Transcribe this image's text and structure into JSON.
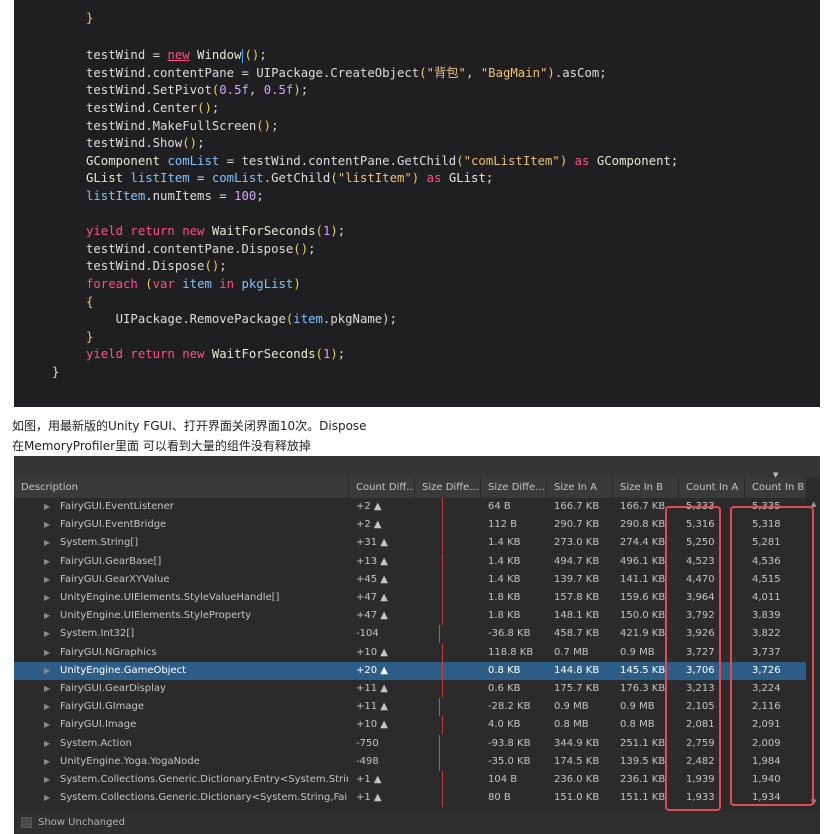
{
  "code_lines": [
    [
      {
        "t": "}",
        "c": "t-punc"
      }
    ],
    [],
    [
      {
        "t": "testWind = ",
        "c": "t-plain"
      },
      {
        "t": "new",
        "c": "t-new"
      },
      {
        "t": " Window",
        "c": "t-type"
      },
      {
        "t": "()",
        "c": "t-punc"
      },
      {
        "t": ";",
        "c": "t-plain"
      }
    ],
    [
      {
        "t": "testWind.contentPane = UIPackage.CreateObject",
        "c": "t-plain"
      },
      {
        "t": "(",
        "c": "t-punc"
      },
      {
        "t": "\"背包\"",
        "c": "t-str"
      },
      {
        "t": ", ",
        "c": "t-plain"
      },
      {
        "t": "\"BagMain\"",
        "c": "t-str"
      },
      {
        "t": ")",
        "c": "t-punc"
      },
      {
        "t": ".asCom;",
        "c": "t-plain"
      }
    ],
    [
      {
        "t": "testWind.SetPivot",
        "c": "t-plain"
      },
      {
        "t": "(",
        "c": "t-punc"
      },
      {
        "t": "0.5f",
        "c": "t-num"
      },
      {
        "t": ", ",
        "c": "t-plain"
      },
      {
        "t": "0.5f",
        "c": "t-num"
      },
      {
        "t": ")",
        "c": "t-punc"
      },
      {
        "t": ";",
        "c": "t-plain"
      }
    ],
    [
      {
        "t": "testWind.Center",
        "c": "t-plain"
      },
      {
        "t": "()",
        "c": "t-punc"
      },
      {
        "t": ";",
        "c": "t-plain"
      }
    ],
    [
      {
        "t": "testWind.MakeFullScreen",
        "c": "t-plain"
      },
      {
        "t": "()",
        "c": "t-punc"
      },
      {
        "t": ";",
        "c": "t-plain"
      }
    ],
    [
      {
        "t": "testWind.Show",
        "c": "t-plain"
      },
      {
        "t": "()",
        "c": "t-punc"
      },
      {
        "t": ";",
        "c": "t-plain"
      }
    ],
    [
      {
        "t": "GComponent ",
        "c": "t-type"
      },
      {
        "t": "comList",
        "c": "t-var"
      },
      {
        "t": " = testWind.contentPane.GetChild",
        "c": "t-plain"
      },
      {
        "t": "(",
        "c": "t-punc"
      },
      {
        "t": "\"comListItem\"",
        "c": "t-str"
      },
      {
        "t": ")",
        "c": "t-punc"
      },
      {
        "t": " as",
        "c": "t-kw"
      },
      {
        "t": " GComponent;",
        "c": "t-type"
      }
    ],
    [
      {
        "t": "GList ",
        "c": "t-type"
      },
      {
        "t": "listItem",
        "c": "t-var"
      },
      {
        "t": " = ",
        "c": "t-plain"
      },
      {
        "t": "comList",
        "c": "t-var"
      },
      {
        "t": ".GetChild",
        "c": "t-plain"
      },
      {
        "t": "(",
        "c": "t-punc"
      },
      {
        "t": "\"listItem\"",
        "c": "t-str"
      },
      {
        "t": ")",
        "c": "t-punc"
      },
      {
        "t": " as",
        "c": "t-kw"
      },
      {
        "t": " GList;",
        "c": "t-type"
      }
    ],
    [
      {
        "t": "listItem",
        "c": "t-var"
      },
      {
        "t": ".numItems = ",
        "c": "t-plain"
      },
      {
        "t": "100",
        "c": "t-num"
      },
      {
        "t": ";",
        "c": "t-plain"
      }
    ],
    [],
    [
      {
        "t": "yield return new",
        "c": "t-kw"
      },
      {
        "t": " WaitForSeconds",
        "c": "t-type"
      },
      {
        "t": "(",
        "c": "t-punc"
      },
      {
        "t": "1",
        "c": "t-num"
      },
      {
        "t": ")",
        "c": "t-punc"
      },
      {
        "t": ";",
        "c": "t-plain"
      }
    ],
    [
      {
        "t": "testWind.contentPane.Dispose",
        "c": "t-plain"
      },
      {
        "t": "()",
        "c": "t-punc"
      },
      {
        "t": ";",
        "c": "t-plain"
      }
    ],
    [
      {
        "t": "testWind.Dispose",
        "c": "t-plain"
      },
      {
        "t": "()",
        "c": "t-punc"
      },
      {
        "t": ";",
        "c": "t-plain"
      }
    ],
    [
      {
        "t": "foreach",
        "c": "t-kw"
      },
      {
        "t": " (",
        "c": "t-punc"
      },
      {
        "t": "var",
        "c": "t-kw"
      },
      {
        "t": " item ",
        "c": "t-var"
      },
      {
        "t": "in",
        "c": "t-kw"
      },
      {
        "t": " pkgList",
        "c": "t-var"
      },
      {
        "t": ")",
        "c": "t-punc"
      }
    ],
    [
      {
        "t": "{",
        "c": "t-punc"
      }
    ],
    [
      {
        "t": "    UIPackage.RemovePackage",
        "c": "t-plain"
      },
      {
        "t": "(",
        "c": "t-punc"
      },
      {
        "t": "item",
        "c": "t-var"
      },
      {
        "t": ".pkgName)",
        "c": "t-plain"
      },
      {
        "t": ";",
        "c": "t-plain"
      }
    ],
    [
      {
        "t": "}",
        "c": "t-punc"
      }
    ],
    [
      {
        "t": "yield return new",
        "c": "t-kw"
      },
      {
        "t": " WaitForSeconds",
        "c": "t-type"
      },
      {
        "t": "(",
        "c": "t-punc"
      },
      {
        "t": "1",
        "c": "t-num"
      },
      {
        "t": ")",
        "c": "t-punc"
      },
      {
        "t": ";",
        "c": "t-plain"
      }
    ],
    [
      {
        "t": "}",
        "c": "t-plain"
      }
    ]
  ],
  "caption": {
    "line1": "如图，用最新版的Unity FGUI、打开界面关闭界面10次。Dispose",
    "line2": "在MemoryProfiler里面 可以看到大量的组件没有释放掉"
  },
  "profiler": {
    "columns": [
      "Description",
      "Count Diff...",
      "Size Diffe...",
      "Size Diffe...",
      "Size In A",
      "Size In B",
      "Count In A",
      "Count In B"
    ],
    "rows": [
      {
        "name": "FairyGUI.EventListener",
        "count_diff": "+2 ▲",
        "size_diff": "64 B",
        "size_a": "166.7 KB",
        "size_b": "166.7 KB",
        "count_a": "5,333",
        "count_b": "5,335"
      },
      {
        "name": "FairyGUI.EventBridge",
        "count_diff": "+2 ▲",
        "size_diff": "112 B",
        "size_a": "290.7 KB",
        "size_b": "290.8 KB",
        "count_a": "5,316",
        "count_b": "5,318"
      },
      {
        "name": "System.String[]",
        "count_diff": "+31 ▲",
        "size_diff": "1.4 KB",
        "size_a": "273.0 KB",
        "size_b": "274.4 KB",
        "count_a": "5,250",
        "count_b": "5,281"
      },
      {
        "name": "FairyGUI.GearBase[]",
        "count_diff": "+13 ▲",
        "size_diff": "1.4 KB",
        "size_a": "494.7 KB",
        "size_b": "496.1 KB",
        "count_a": "4,523",
        "count_b": "4,536"
      },
      {
        "name": "FairyGUI.GearXYValue",
        "count_diff": "+45 ▲",
        "size_diff": "1.4 KB",
        "size_a": "139.7 KB",
        "size_b": "141.1 KB",
        "count_a": "4,470",
        "count_b": "4,515"
      },
      {
        "name": "UnityEngine.UIElements.StyleValueHandle[]",
        "count_diff": "+47 ▲",
        "size_diff": "1.8 KB",
        "size_a": "157.8 KB",
        "size_b": "159.6 KB",
        "count_a": "3,964",
        "count_b": "4,011"
      },
      {
        "name": "UnityEngine.UIElements.StyleProperty",
        "count_diff": "+47 ▲",
        "size_diff": "1.8 KB",
        "size_a": "148.1 KB",
        "size_b": "150.0 KB",
        "count_a": "3,792",
        "count_b": "3,839"
      },
      {
        "name": "System.Int32[]",
        "count_diff": "-104",
        "size_diff": "-36.8 KB",
        "size_a": "458.7 KB",
        "size_b": "421.9 KB",
        "count_a": "3,926",
        "count_b": "3,822"
      },
      {
        "name": "FairyGUI.NGraphics",
        "count_diff": "+10 ▲",
        "size_diff": "118.8 KB",
        "size_a": "0.7 MB",
        "size_b": "0.9 MB",
        "count_a": "3,727",
        "count_b": "3,737"
      },
      {
        "name": "UnityEngine.GameObject",
        "count_diff": "+20 ▲",
        "size_diff": "0.8 KB",
        "size_a": "144.8 KB",
        "size_b": "145.5 KB",
        "count_a": "3,706",
        "count_b": "3,726"
      },
      {
        "name": "FairyGUI.GearDisplay",
        "count_diff": "+11 ▲",
        "size_diff": "0.6 KB",
        "size_a": "175.7 KB",
        "size_b": "176.3 KB",
        "count_a": "3,213",
        "count_b": "3,224"
      },
      {
        "name": "FairyGUI.GImage",
        "count_diff": "+11 ▲",
        "size_diff": "-28.2 KB",
        "size_a": "0.9 MB",
        "size_b": "0.9 MB",
        "count_a": "2,105",
        "count_b": "2,116"
      },
      {
        "name": "FairyGUI.Image",
        "count_diff": "+10 ▲",
        "size_diff": "4.0 KB",
        "size_a": "0.8 MB",
        "size_b": "0.8 MB",
        "count_a": "2,081",
        "count_b": "2,091"
      },
      {
        "name": "System.Action",
        "count_diff": "-750",
        "size_diff": "-93.8 KB",
        "size_a": "344.9 KB",
        "size_b": "251.1 KB",
        "count_a": "2,759",
        "count_b": "2,009"
      },
      {
        "name": "UnityEngine.Yoga.YogaNode",
        "count_diff": "-498",
        "size_diff": "-35.0 KB",
        "size_a": "174.5 KB",
        "size_b": "139.5 KB",
        "count_a": "2,482",
        "count_b": "1,984"
      },
      {
        "name": "System.Collections.Generic.Dictionary.Entry<System.String",
        "count_diff": "+1 ▲",
        "size_diff": "104 B",
        "size_a": "236.0 KB",
        "size_b": "236.1 KB",
        "count_a": "1,939",
        "count_b": "1,940"
      },
      {
        "name": "System.Collections.Generic.Dictionary<System.String,Fairy(",
        "count_diff": "+1 ▲",
        "size_diff": "80 B",
        "size_a": "151.0 KB",
        "size_b": "151.1 KB",
        "count_a": "1,933",
        "count_b": "1,934"
      }
    ],
    "selected_row": 9,
    "footer_label": "Show Unchanged",
    "highlight_color": "#e24a55",
    "selection_color": "#2c5d87"
  }
}
